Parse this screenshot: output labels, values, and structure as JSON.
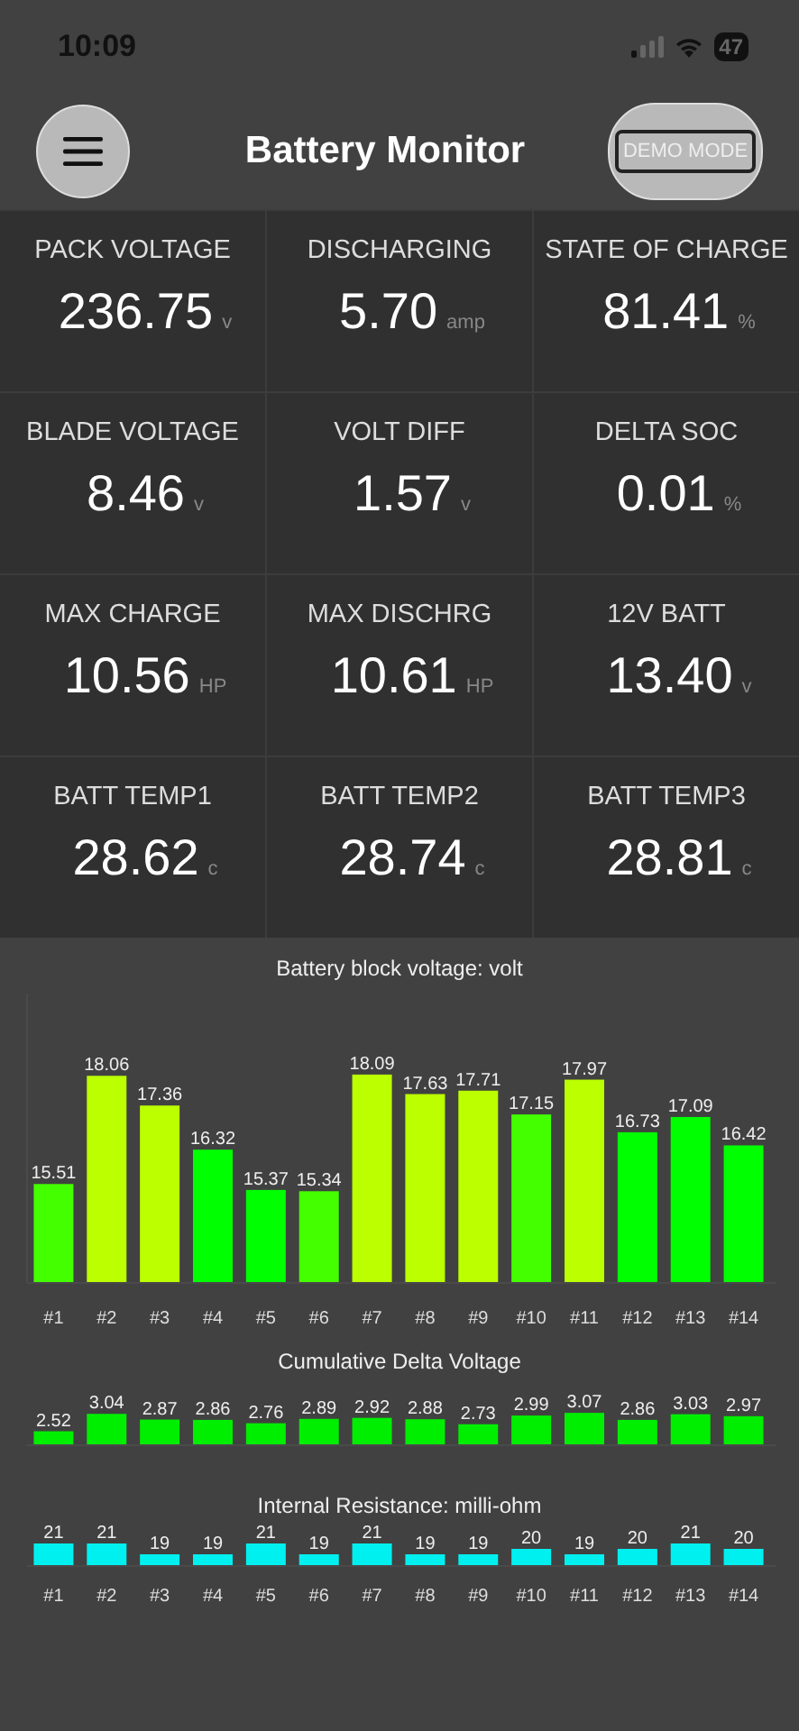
{
  "status_bar": {
    "time": "10:09",
    "battery": "47"
  },
  "header": {
    "title": "Battery Monitor",
    "mode_button": "DEMO MODE"
  },
  "metrics": [
    {
      "label": "PACK VOLTAGE",
      "value": "236.75",
      "unit": "v"
    },
    {
      "label": "DISCHARGING",
      "value": "5.70",
      "unit": "amp"
    },
    {
      "label": "STATE OF CHARGE",
      "value": "81.41",
      "unit": "%"
    },
    {
      "label": "BLADE VOLTAGE",
      "value": "8.46",
      "unit": "v"
    },
    {
      "label": "VOLT DIFF",
      "value": "1.57",
      "unit": "v"
    },
    {
      "label": "DELTA SOC",
      "value": "0.01",
      "unit": "%"
    },
    {
      "label": "MAX CHARGE",
      "value": "10.56",
      "unit": "HP"
    },
    {
      "label": "MAX DISCHRG",
      "value": "10.61",
      "unit": "HP"
    },
    {
      "label": "12V BATT",
      "value": "13.40",
      "unit": "v"
    },
    {
      "label": "BATT TEMP1",
      "value": "28.62",
      "unit": "c"
    },
    {
      "label": "BATT TEMP2",
      "value": "28.74",
      "unit": "c"
    },
    {
      "label": "BATT TEMP3",
      "value": "28.81",
      "unit": "c"
    }
  ],
  "charts": [
    {
      "chart_data": {
        "type": "bar",
        "title": "Battery block voltage: volt",
        "categories": [
          "#1",
          "#2",
          "#3",
          "#4",
          "#5",
          "#6",
          "#7",
          "#8",
          "#9",
          "#10",
          "#11",
          "#12",
          "#13",
          "#14"
        ],
        "data_labels": true,
        "ylim": [
          13.2,
          20
        ],
        "series": [
          {
            "color": "#bbff00",
            "values": [
              null,
              18.06,
              17.36,
              null,
              null,
              null,
              18.09,
              17.63,
              17.71,
              null,
              17.97,
              null,
              null,
              null
            ]
          },
          {
            "color": "#44ff00",
            "values": [
              15.51,
              null,
              null,
              null,
              null,
              15.34,
              null,
              null,
              null,
              17.15,
              null,
              null,
              null,
              null
            ]
          },
          {
            "color": "#00ff00",
            "values": [
              null,
              null,
              null,
              16.32,
              15.37,
              null,
              null,
              null,
              null,
              null,
              null,
              16.73,
              17.09,
              16.42
            ]
          }
        ]
      }
    },
    {
      "chart_data": {
        "type": "bar",
        "title": "Cumulative Delta Voltage",
        "data_labels": true,
        "ylim": [
          2.13,
          3.1
        ],
        "series": [
          {
            "color": "#00ee00",
            "values": [
              2.52,
              3.04,
              2.87,
              2.86,
              2.76,
              2.89,
              2.92,
              2.88,
              2.73,
              2.99,
              3.07,
              2.86,
              3.03,
              2.97
            ]
          }
        ]
      }
    },
    {
      "chart_data": {
        "type": "bar",
        "title": "Internal Resistance: milli-ohm",
        "categories": [
          "#1",
          "#2",
          "#3",
          "#4",
          "#5",
          "#6",
          "#7",
          "#8",
          "#9",
          "#10",
          "#11",
          "#12",
          "#13",
          "#14"
        ],
        "data_labels": true,
        "ylim": [
          17,
          21.5
        ],
        "series": [
          {
            "color": "#00f0f0",
            "values": [
              21,
              21,
              19,
              19,
              21,
              19,
              21,
              19,
              19,
              20,
              19,
              20,
              21,
              20
            ]
          }
        ]
      }
    }
  ]
}
